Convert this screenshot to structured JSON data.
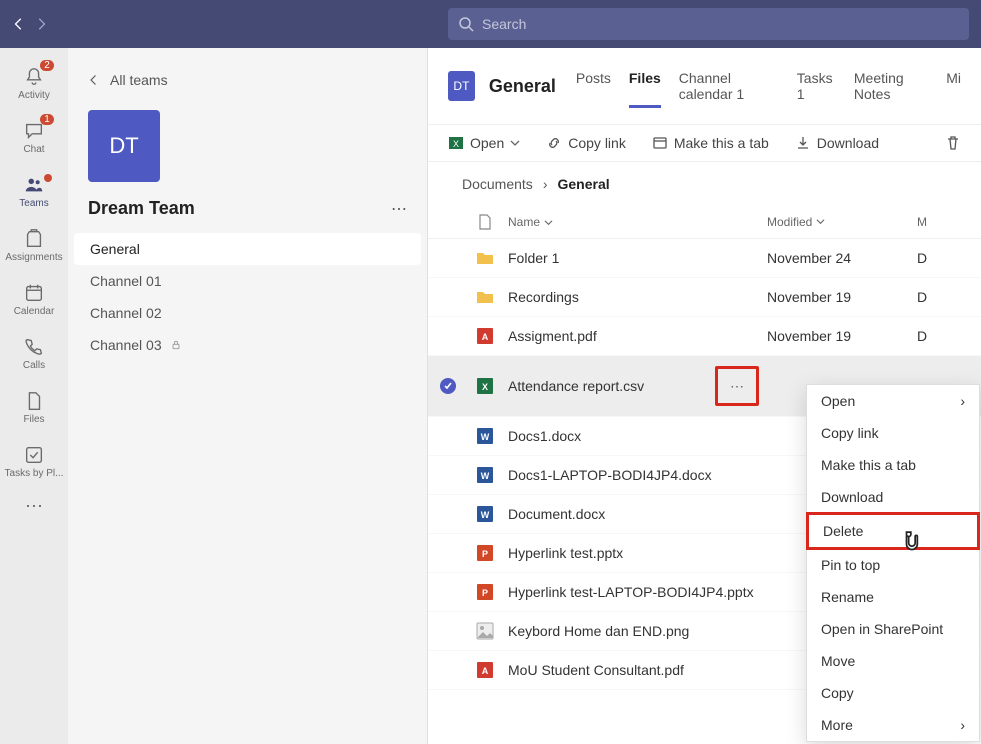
{
  "search": {
    "placeholder": "Search"
  },
  "rail": {
    "items": [
      {
        "id": "activity",
        "label": "Activity",
        "badge": "2"
      },
      {
        "id": "chat",
        "label": "Chat",
        "badge": "1"
      },
      {
        "id": "teams",
        "label": "Teams",
        "dot": true,
        "active": true
      },
      {
        "id": "assignments",
        "label": "Assignments"
      },
      {
        "id": "calendar",
        "label": "Calendar"
      },
      {
        "id": "calls",
        "label": "Calls"
      },
      {
        "id": "files",
        "label": "Files"
      },
      {
        "id": "tasks",
        "label": "Tasks by Pl..."
      }
    ]
  },
  "sidebar": {
    "all_teams": "All teams",
    "team_initials": "DT",
    "team_name": "Dream Team",
    "channels": [
      {
        "name": "General",
        "active": true
      },
      {
        "name": "Channel 01"
      },
      {
        "name": "Channel 02"
      },
      {
        "name": "Channel 03",
        "locked": true
      }
    ]
  },
  "header": {
    "tile": "DT",
    "title": "General",
    "tabs": [
      "Posts",
      "Files",
      "Channel calendar 1",
      "Tasks 1",
      "Meeting Notes",
      "Mi"
    ],
    "active_tab": "Files"
  },
  "toolbar": {
    "open": "Open",
    "copylink": "Copy link",
    "maketab": "Make this a tab",
    "download": "Download"
  },
  "breadcrumb": {
    "root": "Documents",
    "current": "General"
  },
  "columns": {
    "name": "Name",
    "modified": "Modified",
    "modified_by": "M"
  },
  "files": [
    {
      "type": "folder",
      "name": "Folder 1",
      "modified": "November 24",
      "by": "D"
    },
    {
      "type": "folder",
      "name": "Recordings",
      "modified": "November 19",
      "by": "D"
    },
    {
      "type": "pdf",
      "name": "Assigment.pdf",
      "modified": "November 19",
      "by": "D"
    },
    {
      "type": "csv",
      "name": "Attendance report.csv",
      "modified": "",
      "by": "",
      "selected": true,
      "actions": true
    },
    {
      "type": "docx",
      "name": "Docs1.docx",
      "modified": "",
      "by": ""
    },
    {
      "type": "docx",
      "name": "Docs1-LAPTOP-BODI4JP4.docx",
      "modified": "",
      "by": ""
    },
    {
      "type": "docx",
      "name": "Document.docx",
      "modified": "",
      "by": ""
    },
    {
      "type": "pptx",
      "name": "Hyperlink test.pptx",
      "modified": "",
      "by": ""
    },
    {
      "type": "pptx",
      "name": "Hyperlink test-LAPTOP-BODI4JP4.pptx",
      "modified": "",
      "by": ""
    },
    {
      "type": "png",
      "name": "Keybord Home dan END.png",
      "modified": "",
      "by": ""
    },
    {
      "type": "pdf",
      "name": "MoU Student Consultant.pdf",
      "modified": "",
      "by": ""
    }
  ],
  "context_menu": {
    "items": [
      "Open",
      "Copy link",
      "Make this a tab",
      "Download",
      "Delete",
      "Pin to top",
      "Rename",
      "Open in SharePoint",
      "Move",
      "Copy",
      "More"
    ],
    "submenu": [
      "Open",
      "More"
    ],
    "highlighted": "Delete"
  }
}
